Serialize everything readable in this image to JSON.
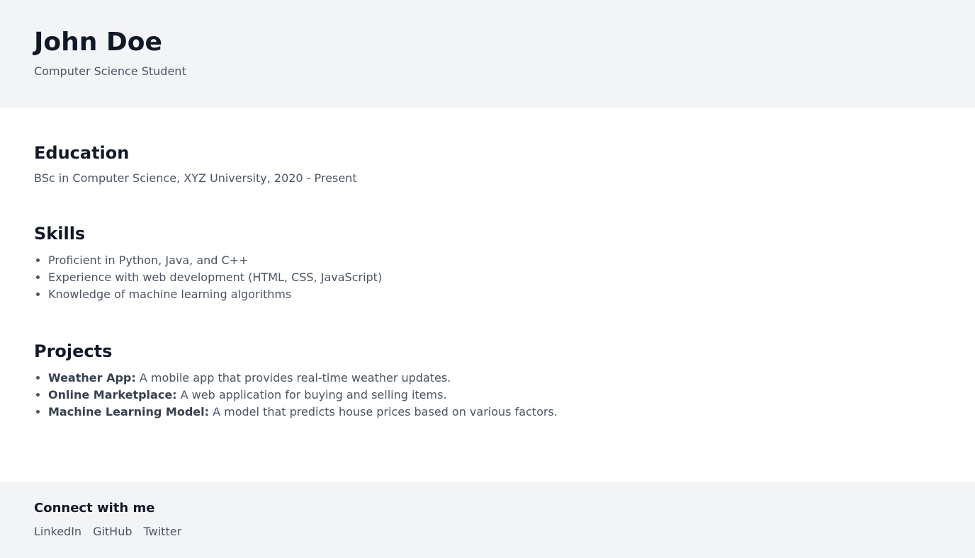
{
  "header": {
    "name": "John Doe",
    "subtitle": "Computer Science Student"
  },
  "education": {
    "heading": "Education",
    "line": "BSc in Computer Science, XYZ University, 2020 - Present"
  },
  "skills": {
    "heading": "Skills",
    "items": [
      "Proficient in Python, Java, and C++",
      "Experience with web development (HTML, CSS, JavaScript)",
      "Knowledge of machine learning algorithms"
    ]
  },
  "projects": {
    "heading": "Projects",
    "items": [
      {
        "title": "Weather App:",
        "desc": " A mobile app that provides real-time weather updates."
      },
      {
        "title": "Online Marketplace:",
        "desc": " A web application for buying and selling items."
      },
      {
        "title": "Machine Learning Model:",
        "desc": " A model that predicts house prices based on various factors."
      }
    ]
  },
  "footer": {
    "title": "Connect with me",
    "links": [
      "LinkedIn",
      "GitHub",
      "Twitter"
    ]
  },
  "colors": {
    "header_bg": "#f3f4f6",
    "heading_text": "#111827",
    "body_text": "#4b5563"
  }
}
